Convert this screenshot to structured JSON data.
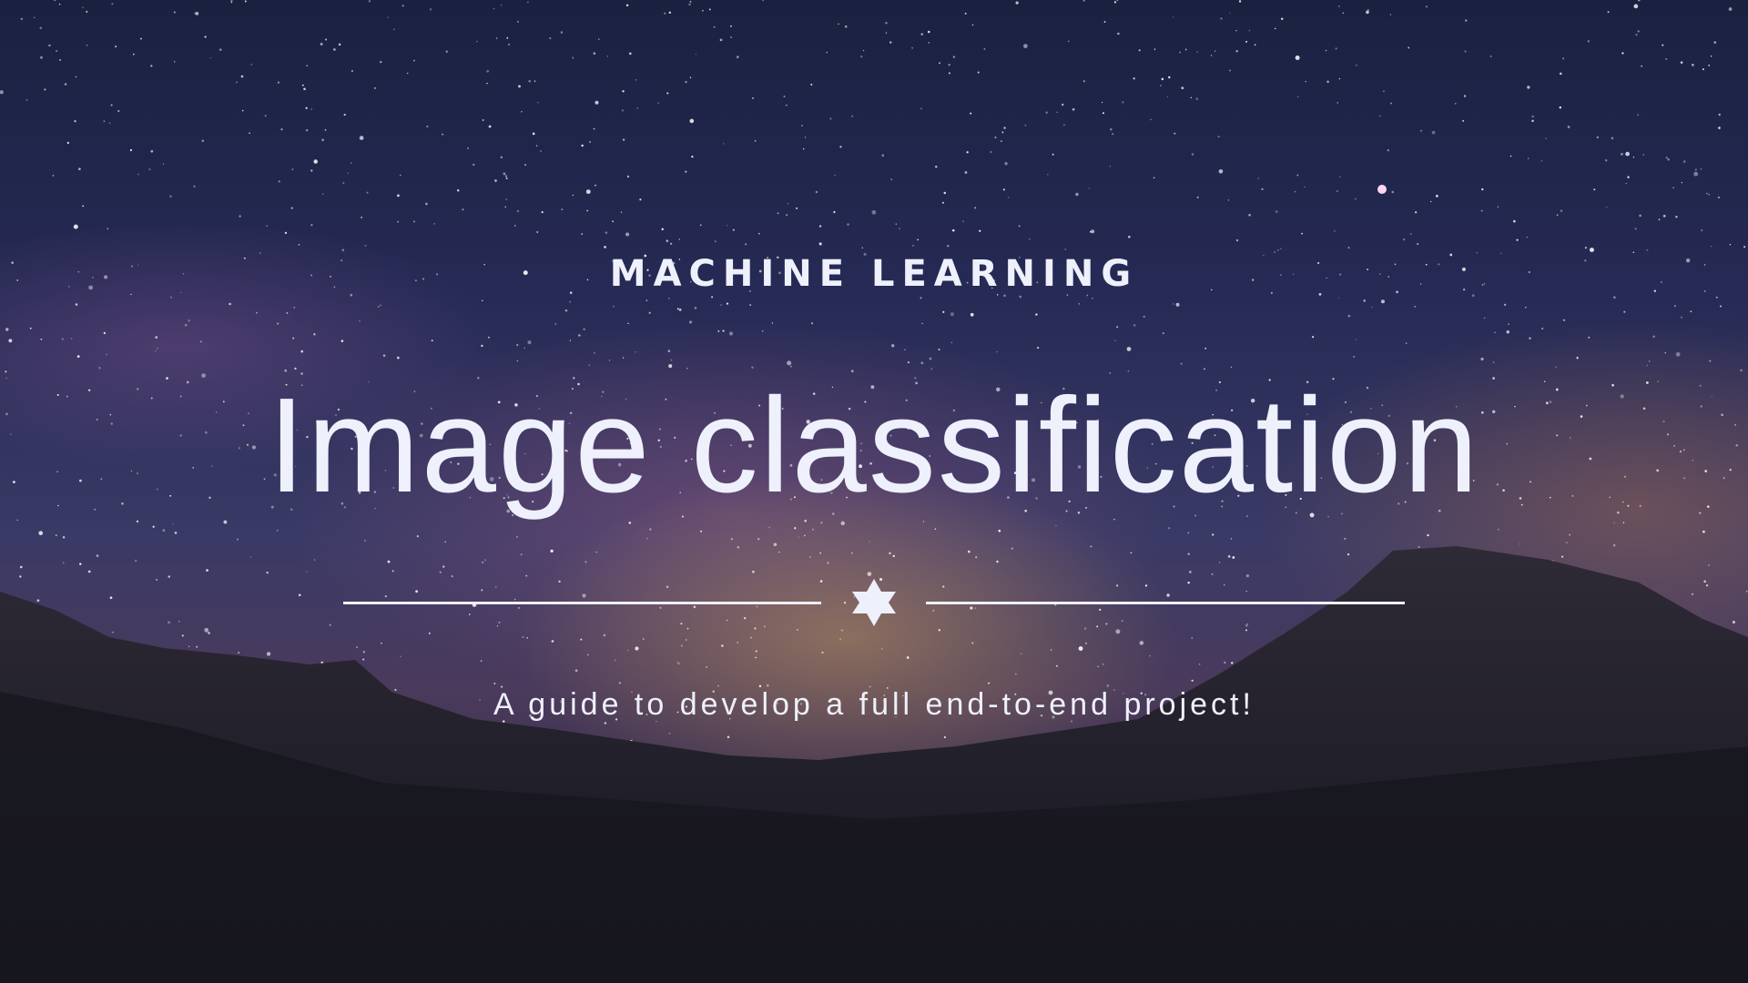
{
  "banner": {
    "kicker": "MACHINE LEARNING",
    "title": "Image classification",
    "subtitle": "A guide to develop a full end-to-end project!",
    "divider_icon": "six-pointed-star-icon",
    "text_color": "#eef0fb"
  }
}
